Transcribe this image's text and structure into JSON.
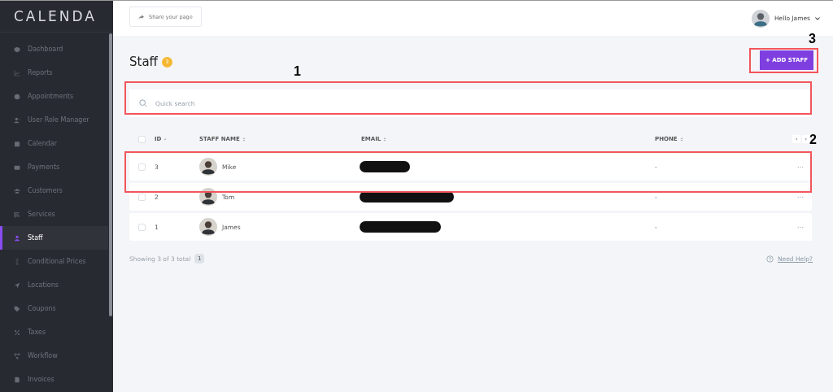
{
  "sidebar": {
    "logo": "CALENDA",
    "items": [
      {
        "label": "Dashboard",
        "selected": false
      },
      {
        "label": "Reports",
        "selected": false
      },
      {
        "label": "Appointments",
        "selected": false
      },
      {
        "label": "User Role Manager",
        "selected": false
      },
      {
        "label": "Calendar",
        "selected": false
      },
      {
        "label": "Payments",
        "selected": false
      },
      {
        "label": "Customers",
        "selected": false
      },
      {
        "label": "Services",
        "selected": false
      },
      {
        "label": "Staff",
        "selected": true
      },
      {
        "label": "Conditional Prices",
        "selected": false
      },
      {
        "label": "Locations",
        "selected": false
      },
      {
        "label": "Coupons",
        "selected": false
      },
      {
        "label": "Taxes",
        "selected": false
      },
      {
        "label": "Workflow",
        "selected": false
      },
      {
        "label": "Invoices",
        "selected": false
      }
    ]
  },
  "header": {
    "share_button": "Share your page",
    "greeting": "Hello James"
  },
  "page": {
    "title": "Staff",
    "count": "3",
    "add_button": "+ ADD STAFF",
    "search": {
      "placeholder": "Quick search"
    }
  },
  "table": {
    "select_all": {
      "checked": false
    },
    "columns": [
      "ID",
      "STAFF NAME",
      "EMAIL",
      "PHONE"
    ],
    "rows": [
      {
        "id": "3",
        "name": "Mike",
        "phone": "-",
        "checked": false
      },
      {
        "id": "2",
        "name": "Tom",
        "phone": "-",
        "checked": false
      },
      {
        "id": "1",
        "name": "James",
        "phone": "-",
        "checked": false
      }
    ]
  },
  "footer": {
    "showing": "Showing 3 of 3 total",
    "page": "1",
    "help": "Need Help?"
  },
  "annotations": [
    {
      "label": "1"
    },
    {
      "label": "2"
    },
    {
      "label": "3"
    }
  ]
}
